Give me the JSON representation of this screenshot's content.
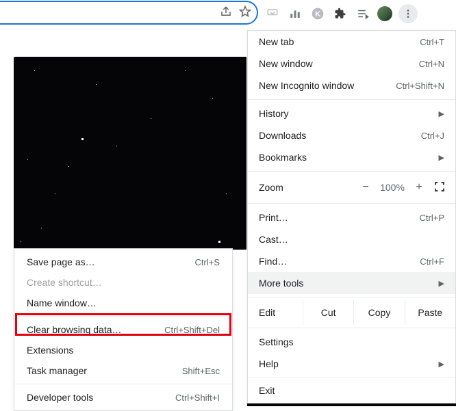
{
  "toolbar": {
    "share_icon": "share-icon",
    "star_icon": "star-icon",
    "icons": [
      "pocket-icon",
      "chart-icon",
      "k-icon",
      "extensions-icon",
      "playlist-icon"
    ]
  },
  "main_menu": {
    "new_tab": "New tab",
    "new_tab_sc": "Ctrl+T",
    "new_window": "New window",
    "new_window_sc": "Ctrl+N",
    "incognito": "New Incognito window",
    "incognito_sc": "Ctrl+Shift+N",
    "history": "History",
    "downloads": "Downloads",
    "downloads_sc": "Ctrl+J",
    "bookmarks": "Bookmarks",
    "zoom_label": "Zoom",
    "zoom_minus": "−",
    "zoom_value": "100%",
    "zoom_plus": "+",
    "print": "Print…",
    "print_sc": "Ctrl+P",
    "cast": "Cast…",
    "find": "Find…",
    "find_sc": "Ctrl+F",
    "more_tools": "More tools",
    "edit": "Edit",
    "cut": "Cut",
    "copy": "Copy",
    "paste": "Paste",
    "settings": "Settings",
    "help": "Help",
    "exit": "Exit"
  },
  "sub_menu": {
    "save_page": "Save page as…",
    "save_page_sc": "Ctrl+S",
    "create_shortcut": "Create shortcut…",
    "name_window": "Name window…",
    "clear_data": "Clear browsing data…",
    "clear_data_sc": "Ctrl+Shift+Del",
    "extensions": "Extensions",
    "task_manager": "Task manager",
    "task_manager_sc": "Shift+Esc",
    "dev_tools": "Developer tools",
    "dev_tools_sc": "Ctrl+Shift+I"
  },
  "highlight": {
    "color": "#e3000f",
    "target": "clear-browsing-data-item"
  }
}
